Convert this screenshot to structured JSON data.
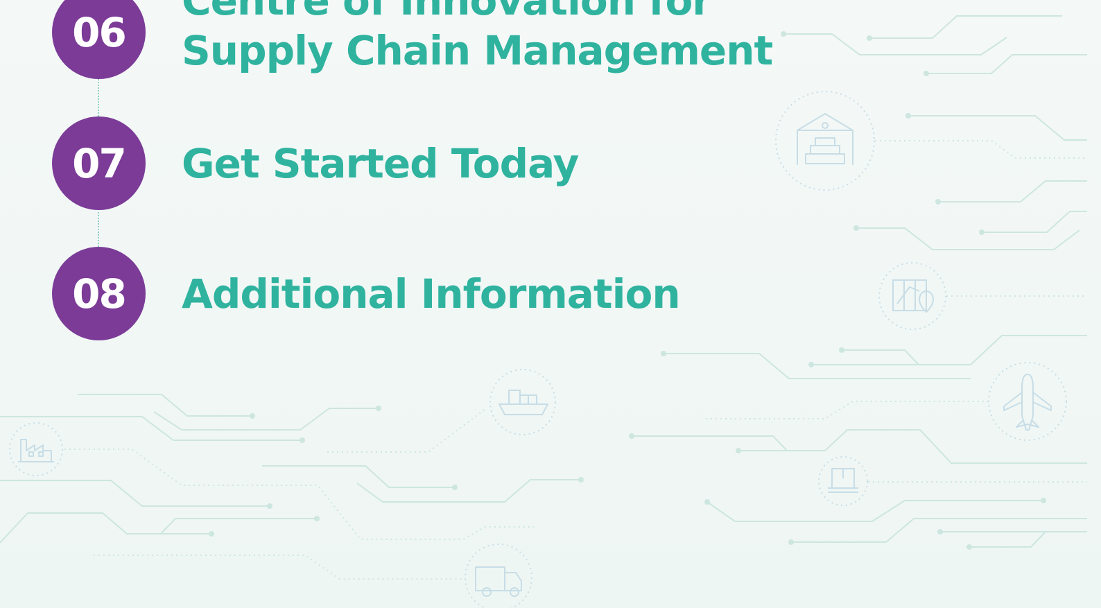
{
  "agenda": {
    "items": [
      {
        "number": "06",
        "title_line1": "Centre of Innovation for",
        "title_line2": "Supply Chain Management"
      },
      {
        "number": "07",
        "title": "Get Started Today"
      },
      {
        "number": "08",
        "title": "Additional Information"
      }
    ]
  },
  "colors": {
    "number_circle": "#7b3b97",
    "title_text": "#2fb39f",
    "circuit_lines": "#cde6df",
    "icon_lines": "#c7dde6"
  },
  "background_icons": [
    "warehouse-icon",
    "route-map-icon",
    "ship-icon",
    "airplane-icon",
    "package-icon",
    "factory-icon",
    "truck-icon"
  ]
}
